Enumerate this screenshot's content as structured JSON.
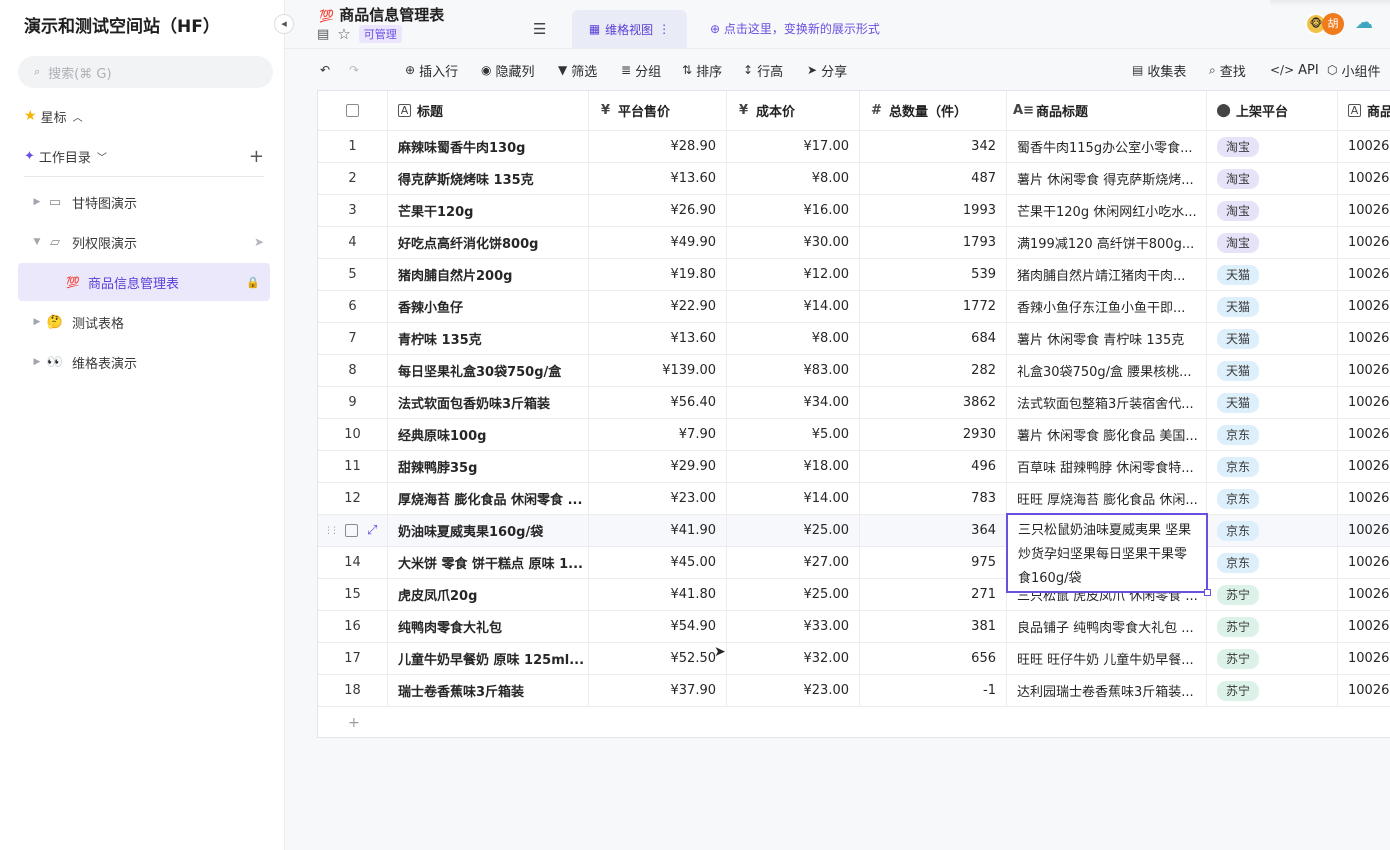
{
  "sidebar": {
    "workspace_title": "演示和测试空间站（HF）",
    "search_placeholder": "搜索(⌘ G)",
    "starred_label": "星标",
    "workdir_label": "工作目录",
    "add_label": "+",
    "items": [
      {
        "label": "甘特图演示",
        "icon": "folder-icon"
      },
      {
        "label": "列权限演示",
        "icon": "folder-icon"
      },
      {
        "label": "商品信息管理表",
        "icon": "100-emoji-icon"
      },
      {
        "label": "测试表格",
        "icon": "thinking-emoji-icon"
      },
      {
        "label": "维格表演示",
        "icon": "eyes-emoji-icon"
      }
    ]
  },
  "header": {
    "title": "商品信息管理表",
    "badge": "可管理",
    "view_tab": "维格视图",
    "switch_hint": "点击这里，变换新的展示形式",
    "avatar_text": "胡"
  },
  "toolbar": {
    "insert_row": "插入行",
    "hide_cols": "隐藏列",
    "filter": "筛选",
    "group": "分组",
    "sort": "排序",
    "row_height": "行高",
    "share": "分享",
    "form": "收集表",
    "find": "查找",
    "api": "API",
    "widget": "小组件"
  },
  "table": {
    "columns": [
      "标题",
      "平台售价",
      "成本价",
      "总数量（件）",
      "商品标题",
      "上架平台",
      "商品"
    ],
    "rows": [
      {
        "no": "1",
        "title": "麻辣味蜀香牛肉130g",
        "price": "¥28.90",
        "cost": "¥17.00",
        "qty": "342",
        "ptitle": "蜀香牛肉115g办公室小零食...",
        "platform": "淘宝",
        "pcolor": "purple",
        "id": "10026"
      },
      {
        "no": "2",
        "title": "得克萨斯烧烤味 135克",
        "price": "¥13.60",
        "cost": "¥8.00",
        "qty": "487",
        "ptitle": "薯片 休闲零食 得克萨斯烧烤...",
        "platform": "淘宝",
        "pcolor": "purple",
        "id": "10026"
      },
      {
        "no": "3",
        "title": "芒果干120g",
        "price": "¥26.90",
        "cost": "¥16.00",
        "qty": "1993",
        "ptitle": "芒果干120g 休闲网红小吃水...",
        "platform": "淘宝",
        "pcolor": "purple",
        "id": "10026"
      },
      {
        "no": "4",
        "title": "好吃点高纤消化饼800g",
        "price": "¥49.90",
        "cost": "¥30.00",
        "qty": "1793",
        "ptitle": "满199减120 高纤饼干800g...",
        "platform": "淘宝",
        "pcolor": "purple",
        "id": "10026"
      },
      {
        "no": "5",
        "title": "猪肉脯自然片200g",
        "price": "¥19.80",
        "cost": "¥12.00",
        "qty": "539",
        "ptitle": "猪肉脯自然片靖江猪肉干肉...",
        "platform": "天猫",
        "pcolor": "blue",
        "id": "10026"
      },
      {
        "no": "6",
        "title": "香辣小鱼仔",
        "price": "¥22.90",
        "cost": "¥14.00",
        "qty": "1772",
        "ptitle": "香辣小鱼仔东江鱼小鱼干即...",
        "platform": "天猫",
        "pcolor": "blue",
        "id": "10026"
      },
      {
        "no": "7",
        "title": "青柠味 135克",
        "price": "¥13.60",
        "cost": "¥8.00",
        "qty": "684",
        "ptitle": "薯片 休闲零食 青柠味 135克",
        "platform": "天猫",
        "pcolor": "blue",
        "id": "10026"
      },
      {
        "no": "8",
        "title": "每日坚果礼盒30袋750g/盒",
        "price": "¥139.00",
        "cost": "¥83.00",
        "qty": "282",
        "ptitle": "礼盒30袋750g/盒 腰果核桃...",
        "platform": "天猫",
        "pcolor": "blue",
        "id": "10026"
      },
      {
        "no": "9",
        "title": "法式软面包香奶味3斤箱装",
        "price": "¥56.40",
        "cost": "¥34.00",
        "qty": "3862",
        "ptitle": "法式软面包整箱3斤装宿舍代...",
        "platform": "天猫",
        "pcolor": "blue",
        "id": "10026"
      },
      {
        "no": "10",
        "title": "经典原味100g",
        "price": "¥7.90",
        "cost": "¥5.00",
        "qty": "2930",
        "ptitle": "薯片 休闲零食 膨化食品 美国...",
        "platform": "京东",
        "pcolor": "blue",
        "id": "10026"
      },
      {
        "no": "11",
        "title": "甜辣鸭脖35g",
        "price": "¥29.90",
        "cost": "¥18.00",
        "qty": "496",
        "ptitle": "百草味 甜辣鸭脖 休闲零食特...",
        "platform": "京东",
        "pcolor": "blue",
        "id": "10026"
      },
      {
        "no": "12",
        "title": "厚烧海苔 膨化食品 休闲零食 ...",
        "price": "¥23.00",
        "cost": "¥14.00",
        "qty": "783",
        "ptitle": "旺旺 厚烧海苔 膨化食品 休闲...",
        "platform": "京东",
        "pcolor": "blue",
        "id": "10026"
      },
      {
        "no": "13",
        "title": "奶油味夏威夷果160g/袋",
        "price": "¥41.90",
        "cost": "¥25.00",
        "qty": "364",
        "ptitle": "",
        "platform": "京东",
        "pcolor": "blue",
        "id": "10026"
      },
      {
        "no": "14",
        "title": "大米饼 零食 饼干糕点 原味 1...",
        "price": "¥45.00",
        "cost": "¥27.00",
        "qty": "975",
        "ptitle": "",
        "platform": "京东",
        "pcolor": "blue",
        "id": "10026"
      },
      {
        "no": "15",
        "title": "虎皮凤爪20g",
        "price": "¥41.80",
        "cost": "¥25.00",
        "qty": "271",
        "ptitle": "三只松鼠 虎皮凤爪 休闲零食 ...",
        "platform": "苏宁",
        "pcolor": "green",
        "id": "10026"
      },
      {
        "no": "16",
        "title": "纯鸭肉零食大礼包",
        "price": "¥54.90",
        "cost": "¥33.00",
        "qty": "381",
        "ptitle": "良品铺子 纯鸭肉零食大礼包 ...",
        "platform": "苏宁",
        "pcolor": "green",
        "id": "10026"
      },
      {
        "no": "17",
        "title": "儿童牛奶早餐奶 原味 125ml...",
        "price": "¥52.50",
        "cost": "¥32.00",
        "qty": "656",
        "ptitle": "旺旺 旺仔牛奶 儿童牛奶早餐...",
        "platform": "苏宁",
        "pcolor": "green",
        "id": "10026"
      },
      {
        "no": "18",
        "title": "瑞士卷香蕉味3斤箱装",
        "price": "¥37.90",
        "cost": "¥23.00",
        "qty": "-1",
        "ptitle": "达利园瑞士卷香蕉味3斤箱装...",
        "platform": "苏宁",
        "pcolor": "green",
        "id": "10026"
      }
    ],
    "add_row": "+"
  },
  "expanded_cell": {
    "text": "三只松鼠奶油味夏威夷果 坚果炒货孕妇坚果每日坚果干果零食160g/袋"
  }
}
